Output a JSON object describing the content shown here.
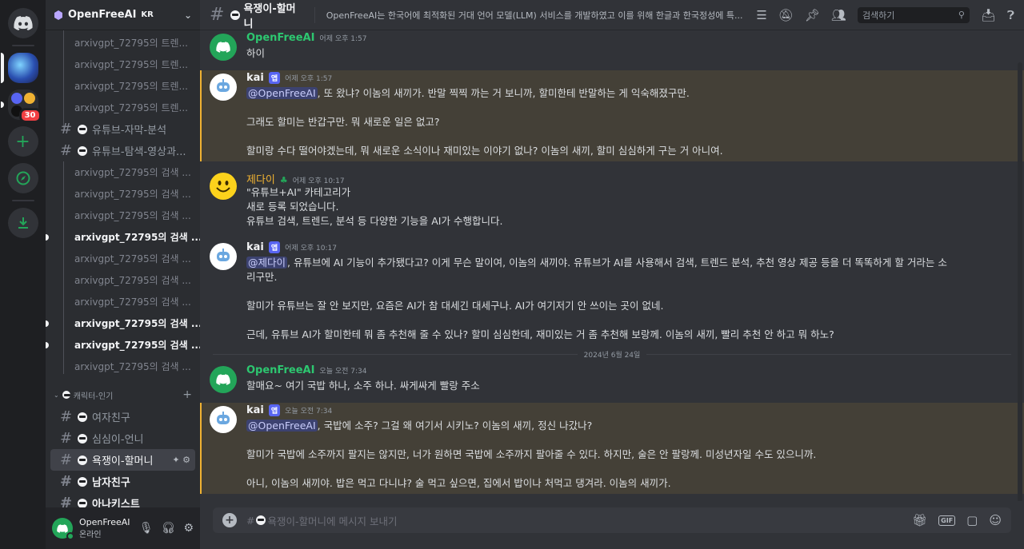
{
  "server": {
    "name": "OpenFreeAI",
    "region_tag": "KR"
  },
  "rail": {
    "mention_badge": "30"
  },
  "sidebar": {
    "top_threads": [
      {
        "label": "arxivgpt_72795의 트렌...",
        "bold": false,
        "unread": false
      },
      {
        "label": "arxivgpt_72795의 트렌...",
        "bold": false,
        "unread": false
      },
      {
        "label": "arxivgpt_72795의 트렌...",
        "bold": false,
        "unread": false
      },
      {
        "label": "arxivgpt_72795의 트렌...",
        "bold": false,
        "unread": false
      }
    ],
    "channel_a": "유튜브-자막-분석",
    "channel_b": "유튜브-탐색-영상과...",
    "threads": [
      {
        "label": "arxivgpt_72795의 검색 ...",
        "bold": false,
        "unread": false
      },
      {
        "label": "arxivgpt_72795의 검색 ...",
        "bold": false,
        "unread": false
      },
      {
        "label": "arxivgpt_72795의 검색 ...",
        "bold": false,
        "unread": false
      },
      {
        "label": "arxivgpt_72795의 검색 ...",
        "bold": true,
        "unread": true
      },
      {
        "label": "arxivgpt_72795의 검색 ...",
        "bold": false,
        "unread": false
      },
      {
        "label": "arxivgpt_72795의 검색 ...",
        "bold": false,
        "unread": false
      },
      {
        "label": "arxivgpt_72795의 검색 ...",
        "bold": false,
        "unread": false
      },
      {
        "label": "arxivgpt_72795의 검색 ...",
        "bold": true,
        "unread": true
      },
      {
        "label": "arxivgpt_72795의 검색 ...",
        "bold": true,
        "unread": true
      },
      {
        "label": "arxivgpt_72795의 검색 ...",
        "bold": false,
        "unread": false
      }
    ],
    "category": "캐릭터-인기",
    "category_channels": [
      {
        "label": "여자친구",
        "bold": false,
        "unread": false,
        "active": false
      },
      {
        "label": "심심이-언니",
        "bold": false,
        "unread": false,
        "active": false
      },
      {
        "label": "욕쟁이-할머니",
        "bold": false,
        "unread": false,
        "active": true
      },
      {
        "label": "남자친구",
        "bold": true,
        "unread": true,
        "active": false
      },
      {
        "label": "아나키스트",
        "bold": true,
        "unread": true,
        "active": false
      }
    ]
  },
  "user": {
    "name": "OpenFreeAI",
    "status": "온라인"
  },
  "header": {
    "channel_name": "욕쟁이-할머니",
    "topic": "OpenFreeAI는 한국어에 최적화된 거대 언어 모델(LLM) 서비스를 개발하였고 이를 위해 한글과 한국정성에 특...",
    "search_placeholder": "검색하기"
  },
  "messages": {
    "m1": {
      "author": "OpenFreeAI",
      "time": "어제 오후 1:57",
      "lines": [
        "하이"
      ]
    },
    "m2": {
      "author": "kai",
      "tag": "앱",
      "time": "어제 오후 1:57",
      "mention": "@OpenFreeAI",
      "first": ", 또 왔냐? 이놈의 새끼가. 반말 찍찍 까는 거 보니까, 할미한테 반말하는 게 익숙해졌구만.",
      "rest": [
        "",
        "그래도 할미는 반갑구만. 뭐 새로운 일은 없고?",
        "",
        "할미랑 수다 떨어야겠는데, 뭐 새로운 소식이나 재미있는 이야기 없나? 이놈의 새끼, 할미 심심하게 구는 거 아니여."
      ]
    },
    "m3": {
      "author": "제다이",
      "time": "어제 오후 10:17",
      "lines": [
        "\"유튜브+AI\" 카테고리가",
        "새로 등록 되었습니다.",
        "유튜브 검색, 트렌드, 분석 등 다양한 기능을 AI가 수행합니다."
      ]
    },
    "m4": {
      "author": "kai",
      "tag": "앱",
      "time": "어제 오후 10:17",
      "mention": "@제다이",
      "first": ", 유튜브에 AI 기능이 추가됐다고? 이게 무슨 말이여, 이놈의 새끼야. 유튜브가 AI를 사용해서 검색, 트렌드 분석, 추천 영상 제공 등을 더 똑똑하게 할 거라는 소",
      "rest": [
        "리구만.",
        "",
        "할미가 유튜브는 잘 안 보지만, 요즘은 AI가 참 대세긴 대세구나. AI가 여기저기 안 쓰이는 곳이 없네.",
        "",
        "근데, 유튜브 AI가 할미한테 뭐 좀 추천해 줄 수 있나? 할미 심심한데, 재미있는 거 좀 추천해 보랑께. 이놈의 새끼, 빨리 추천 안 하고 뭐 하노?"
      ]
    },
    "date_divider": "2024년 6월 24일",
    "m5": {
      "author": "OpenFreeAI",
      "time": "오늘 오전 7:34",
      "lines": [
        "할매요~ 여기 국밥 하나, 소주 하나. 싸게싸게 빨랑 주소"
      ]
    },
    "m6": {
      "author": "kai",
      "tag": "앱",
      "time": "오늘 오전 7:34",
      "mention": "@OpenFreeAI",
      "first": ", 국밥에 소주? 그걸 왜 여기서 시키노? 이놈의 새끼, 정신 나갔나?",
      "rest": [
        "",
        "할미가 국밥에 소주까지 팔지는 않지만, 너가 원하면 국밥에 소주까지 팔아줄 수 있다. 하지만, 술은 안 팔랑께. 미성년자일 수도 있으니까.",
        "",
        "아니, 이놈의 새끼야. 밥은 먹고 다니냐? 술 먹고 싶으면, 집에서 밥이나 처먹고 댕겨라. 이놈의 새끼가."
      ]
    }
  },
  "composer": {
    "placeholder": "욕쟁이-할머니에 메시지 보내기"
  },
  "colors": {
    "accent": "#5865f2",
    "online": "#23a559",
    "mention_highlight": "#444037",
    "mention_border": "#f0b232"
  }
}
